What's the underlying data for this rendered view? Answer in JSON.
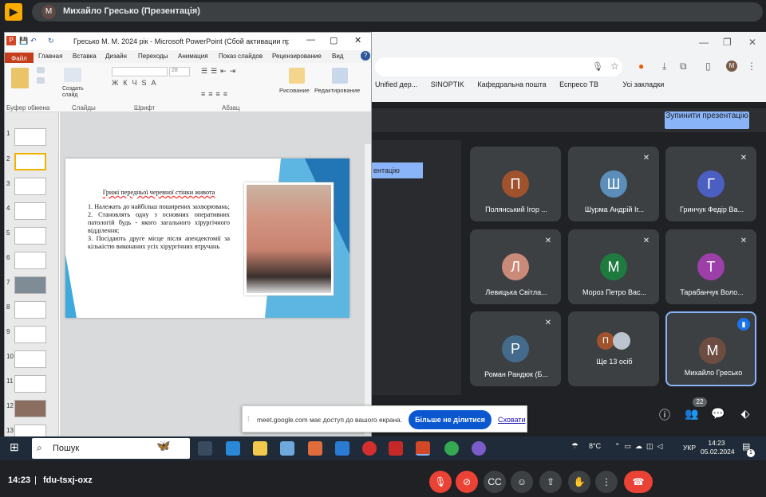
{
  "meet": {
    "presenter_title": "Михайло Гресько (Презентація)",
    "presenter_initial": "М",
    "stop_presenting": "Зупинити презентацію",
    "time": "14:23",
    "separator": "|",
    "code": "fdu-tsxj-oxz",
    "people_count": "22"
  },
  "browser": {
    "bookmarks": [
      "Unified дер...",
      "SINOPTIK",
      "Кафедральна пошта",
      "Еспресо ТВ",
      "Усі закладки"
    ],
    "profile_initial": "М"
  },
  "ppt": {
    "window_title": "Гресько М. М. 2024 рік - Microsoft PowerPoint (Сбой активации пр...",
    "tabs": [
      "Файл",
      "Главная",
      "Вставка",
      "Дизайн",
      "Переходы",
      "Анимация",
      "Показ слайдов",
      "Рецензирование",
      "Вид"
    ],
    "groups": [
      "Буфер обмена",
      "Слайды",
      "Шрифт",
      "Абзац",
      "Рисование",
      "Редактирование"
    ],
    "create_slide": "Создать слайд",
    "font_size": "28",
    "slide_numbers": [
      "1",
      "2",
      "3",
      "4",
      "5",
      "6",
      "7",
      "8",
      "9",
      "10",
      "11",
      "12",
      "13"
    ],
    "slide": {
      "title": "Грижі передньої черевної стінки живота",
      "p1": "1. Належать до найбільш поширених захворювань;",
      "p2": "2. Становлять одну з основних оперативних патологій будь - якого загального хірургічного відділення;",
      "p3": "3. Посідають друге місце після апендектомії за кількістю виконаних усіх хірургічних втручань"
    }
  },
  "tiles": [
    {
      "name": "Полянський Ігор ...",
      "initial": "П",
      "color": "#a0522d",
      "muted": false
    },
    {
      "name": "Шурма Андрій Іг...",
      "initial": "Ш",
      "color": "#5b8fb9",
      "muted": true
    },
    {
      "name": "Гринчук Федір Ва...",
      "initial": "Г",
      "color": "#4a5fc1",
      "muted": true
    },
    {
      "name": "Левицька Світла...",
      "initial": "Л",
      "color": "#c98a7a",
      "muted": true
    },
    {
      "name": "Мороз Петро Вас...",
      "initial": "М",
      "color": "#1e7a3e",
      "muted": true
    },
    {
      "name": "Тарабанчук Воло...",
      "initial": "Т",
      "color": "#9c3fa8",
      "muted": true
    },
    {
      "name": "Роман Рандюк (Б...",
      "initial": "Р",
      "color": "#456b8c",
      "muted": true
    },
    {
      "name": "Ще 13 осіб",
      "initial": "П",
      "color": "#a0522d",
      "muted": false
    },
    {
      "name": "Михайло Гресько",
      "initial": "М",
      "color": "#6d4c41",
      "muted": false
    }
  ],
  "share_notice": {
    "text": "meet.google.com має доступ до вашого екрана.",
    "stop_button": "Більше не ділитися",
    "hide_link": "Сховати"
  },
  "taskbar": {
    "search": "Пошук",
    "weather": "8°C",
    "lang": "УКР",
    "clock_time": "14:23",
    "clock_date": "05.02.2024",
    "notif_count": "1"
  }
}
